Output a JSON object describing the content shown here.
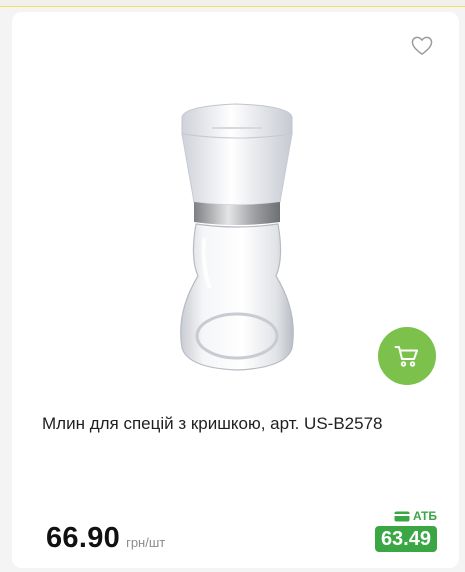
{
  "product": {
    "title": "Млин для спецій з кришкою, арт. US-B2578",
    "price": "66.90",
    "unit": "грн/шт"
  },
  "promo": {
    "label": "АТБ",
    "price": "63.49",
    "color": "#3aa644"
  },
  "icons": {
    "favorite": "heart-outline-icon",
    "cart": "shopping-cart-icon",
    "promo": "card-icon"
  },
  "colors": {
    "cart_button": "#7cc14c",
    "top_accent": "#f3dd6a"
  }
}
